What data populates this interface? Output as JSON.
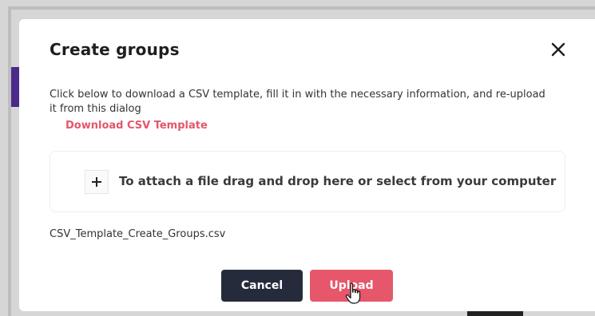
{
  "modal": {
    "title": "Create groups",
    "description": "Click below to download a CSV template, fill it in with the necessary information, and re-upload it from this dialog",
    "download_link": "Download CSV Template",
    "dropzone_text": "To attach a file drag and drop here or select from your computer",
    "attached_file": "CSV_Template_Create_Groups.csv",
    "cancel_label": "Cancel",
    "upload_label": "Upload"
  },
  "icons": {
    "close": "close-icon",
    "plus": "plus-icon",
    "cursor": "hand-pointer-icon"
  },
  "colors": {
    "accent": "#e4566a",
    "cancel_bg": "#262b3c",
    "upload_bg": "#e6576b",
    "backdrop_accent": "#4b2a8c"
  }
}
